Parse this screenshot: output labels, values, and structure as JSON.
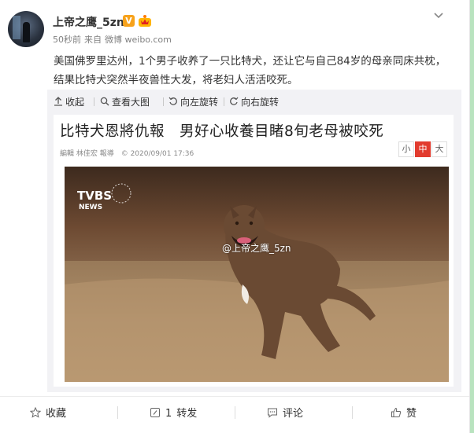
{
  "post": {
    "username": "上帝之鹰_5zn",
    "verified_badge": "V",
    "time": "50秒前",
    "source_prefix": "来自",
    "source": "微博 weibo.com",
    "text": "美国佛罗里达州，1个男子收养了一只比特犬，还让它与自己84岁的母亲同床共枕，结果比特犬突然半夜兽性大发，将老妇人活活咬死。"
  },
  "media_toolbar": {
    "collapse": "收起",
    "view_large": "查看大图",
    "rotate_left": "向左旋转",
    "rotate_right": "向右旋转"
  },
  "news": {
    "headline": "比特犬恩將仇報　男好心收養目睹8旬老母被咬死",
    "byline": "編輯 林佳宏 報導　© 2020/09/01 17:36",
    "size_small": "小",
    "size_medium": "中",
    "size_large": "大",
    "logo_text": "TVBS",
    "logo_sub": "NEWS",
    "watermark": "@上帝之鹰_5zn"
  },
  "actions": {
    "favorite": "收藏",
    "repost_count": "1",
    "repost": "转发",
    "comment": "评论",
    "like": "赞"
  },
  "colors": {
    "accent_red": "#e23b2e",
    "verified_orange": "#f7a21b",
    "side_strip_green": "#b9e3bf"
  }
}
